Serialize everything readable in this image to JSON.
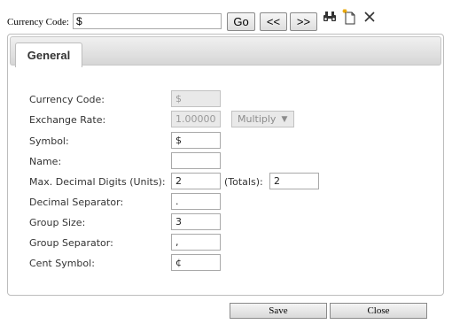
{
  "toolbar": {
    "code_label": "Currency Code:",
    "code_value": "$",
    "go_label": "Go",
    "prev_label": "<<",
    "next_label": ">>",
    "icons": [
      "binoculars-icon",
      "new-document-icon",
      "close-icon"
    ]
  },
  "tabs": [
    {
      "label": "General",
      "active": true
    }
  ],
  "form": {
    "currency_code": {
      "label": "Currency Code:",
      "value": "$",
      "disabled": true
    },
    "exchange_rate": {
      "label": "Exchange Rate:",
      "value": "1.000000",
      "disabled": true
    },
    "rate_mode": {
      "selected": "Multiply",
      "disabled": true
    },
    "symbol": {
      "label": "Symbol:",
      "value": "$"
    },
    "name": {
      "label": "Name:",
      "value": ""
    },
    "max_decimal": {
      "label": "Max. Decimal Digits (Units):",
      "value": "2",
      "totals_label": "(Totals):",
      "totals_value": "2"
    },
    "decimal_separator": {
      "label": "Decimal Separator:",
      "value": "."
    },
    "group_size": {
      "label": "Group Size:",
      "value": "3"
    },
    "group_separator": {
      "label": "Group Separator:",
      "value": ","
    },
    "cent_symbol": {
      "label": "Cent Symbol:",
      "value": "¢"
    }
  },
  "actions": {
    "save_label": "Save",
    "close_label": "Close"
  }
}
